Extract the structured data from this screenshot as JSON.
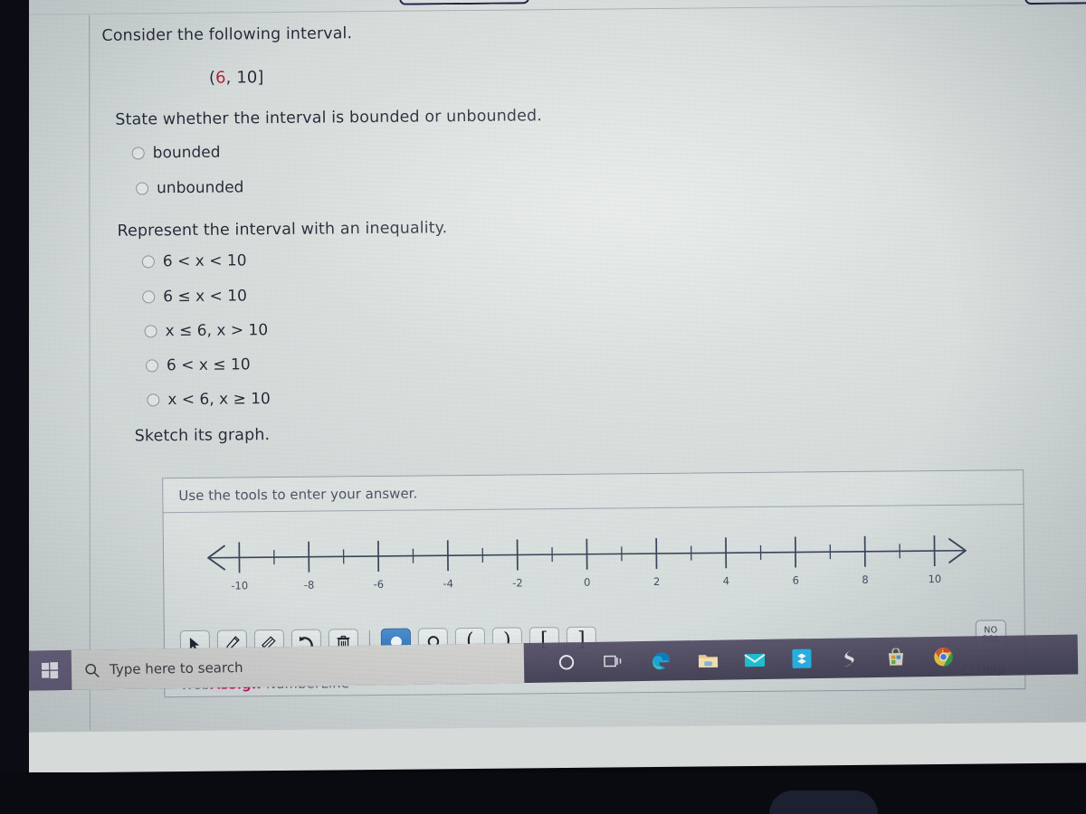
{
  "question": {
    "prompt": "Consider the following interval.",
    "interval_open": "(",
    "interval_a": "6",
    "interval_rest": ", 10]",
    "bounded_prompt": "State whether the interval is bounded or unbounded.",
    "bounded_options": [
      {
        "label": "bounded",
        "selected": false
      },
      {
        "label": "unbounded",
        "selected": false
      }
    ],
    "inequality_prompt": "Represent the interval with an inequality.",
    "inequality_options": [
      {
        "label": "6 < x < 10",
        "selected": false
      },
      {
        "label": "6 ≤ x < 10",
        "selected": false
      },
      {
        "label": "x ≤ 6, x > 10",
        "selected": false
      },
      {
        "label": "6 < x ≤ 10",
        "selected": false
      },
      {
        "label": "x < 6, x ≥ 10",
        "selected": false
      }
    ],
    "sketch_prompt": "Sketch its graph.",
    "highlight_color": "#b0243a"
  },
  "tool_panel": {
    "header": "Use the tools to enter your answer.",
    "nosol_line1": "NO",
    "nosol_line2": "SOL",
    "help_label": "Help",
    "brand_web": "Web",
    "brand_assign": "Assign",
    "brand_product": "NumberLine",
    "brand_accent": "#c0185f",
    "active_tool": "closed-point",
    "tools": [
      {
        "name": "select-arrow-tool",
        "glyph": "pointer",
        "active": false
      },
      {
        "name": "pen-tool",
        "glyph": "pen",
        "active": false
      },
      {
        "name": "eraser-tool",
        "glyph": "eraser",
        "active": false
      },
      {
        "name": "undo-tool",
        "glyph": "undo",
        "active": false
      },
      {
        "name": "delete-tool",
        "glyph": "trash",
        "active": false
      },
      {
        "name": "closed-point-tool",
        "glyph": "filled-circle",
        "active": true
      },
      {
        "name": "open-point-tool",
        "glyph": "open-circle",
        "active": false
      },
      {
        "name": "open-paren-left-tool",
        "glyph": "(",
        "active": false
      },
      {
        "name": "open-paren-right-tool",
        "glyph": ")",
        "active": false
      },
      {
        "name": "bracket-left-tool",
        "glyph": "[",
        "active": false
      },
      {
        "name": "bracket-right-tool",
        "glyph": "]",
        "active": false
      }
    ]
  },
  "chart_data": {
    "type": "line",
    "title": "",
    "xlabel": "",
    "ylabel": "",
    "xlim": [
      -11,
      11
    ],
    "major_tick_values": [
      -10,
      -8,
      -6,
      -4,
      -2,
      0,
      2,
      4,
      6,
      8,
      10
    ],
    "major_tick_labels": [
      "-10",
      "-8",
      "-6",
      "-4",
      "-2",
      "0",
      "2",
      "4",
      "6",
      "8",
      "10"
    ],
    "minor_tick_values": [
      -9,
      -7,
      -5,
      -3,
      -1,
      1,
      3,
      5,
      7,
      9
    ],
    "arrow_left": true,
    "arrow_right": true,
    "plotted_points": [],
    "plotted_segments": [],
    "axis_color": "#39465c",
    "grid": false,
    "legend": "none"
  },
  "taskbar": {
    "search_placeholder": "Type here to search",
    "start_icon": "windows-logo-icon",
    "search_icon": "search-icon",
    "tray": [
      {
        "name": "cortana-icon"
      },
      {
        "name": "task-view-icon"
      },
      {
        "name": "edge-browser-icon"
      },
      {
        "name": "file-explorer-icon"
      },
      {
        "name": "mail-icon"
      },
      {
        "name": "dropbox-icon"
      },
      {
        "name": "lightning-app-icon"
      },
      {
        "name": "microsoft-store-icon"
      },
      {
        "name": "chrome-browser-icon"
      }
    ]
  }
}
